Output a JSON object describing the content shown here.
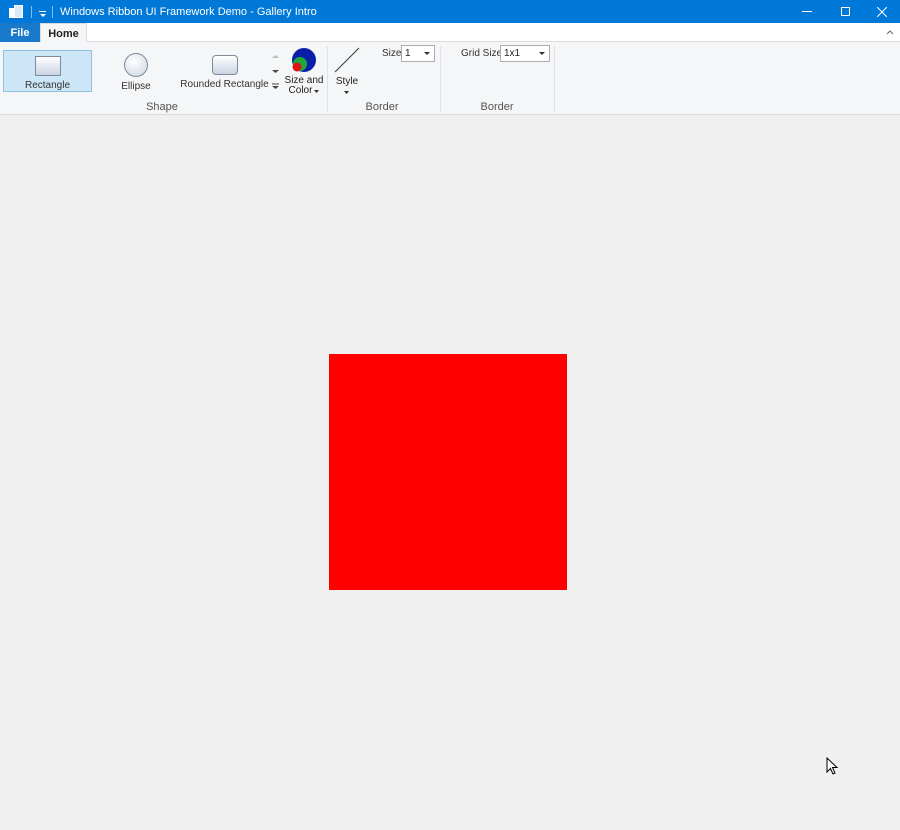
{
  "window": {
    "title": "Windows Ribbon UI Framework Demo - Gallery Intro"
  },
  "tabs": {
    "file": "File",
    "home": "Home"
  },
  "ribbon": {
    "shape_group": {
      "label": "Shape",
      "items": [
        {
          "label": "Rectangle",
          "selected": true
        },
        {
          "label": "Ellipse",
          "selected": false
        },
        {
          "label": "Rounded Rectangle",
          "selected": false
        }
      ],
      "size_and_color_label_line1": "Size and",
      "size_and_color_label_line2": "Color"
    },
    "border_group": {
      "label": "Border",
      "style_label": "Style",
      "size_label": "Size",
      "size_value": "1"
    },
    "grid_group": {
      "label": "Border",
      "grid_size_label": "Grid Size",
      "grid_size_value": "1x1"
    }
  },
  "canvas": {
    "shape_color": "#ff0000"
  },
  "colors": {
    "title_bar": "#0078d7",
    "file_tab": "#1979ca",
    "selected_item": "#cde6f7"
  }
}
